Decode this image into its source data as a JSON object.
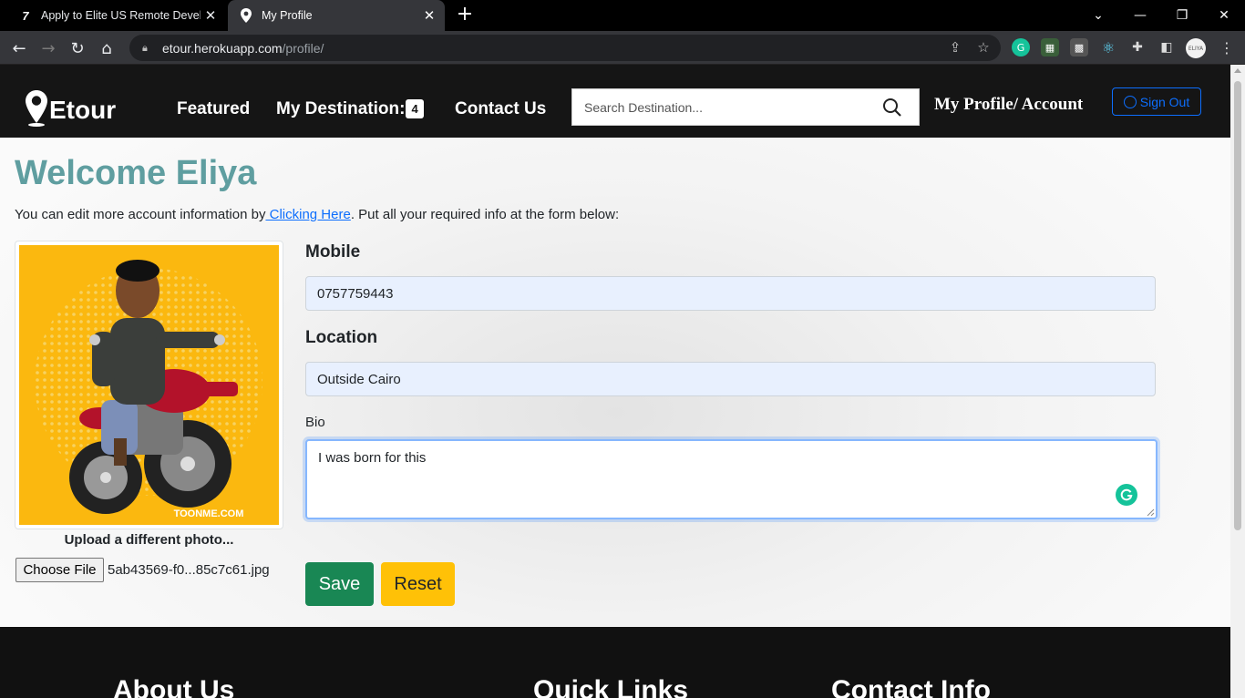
{
  "browser": {
    "tabs": [
      {
        "title": "Apply to Elite US Remote Develop",
        "active": false,
        "favicon": "turing-icon"
      },
      {
        "title": "My Profile",
        "active": true,
        "favicon": "etour-pin-icon"
      }
    ],
    "url_host": "etour.herokuapp.com",
    "url_path": "/profile/"
  },
  "nav": {
    "brand": "Etour",
    "featured": "Featured",
    "destinations": "My Destination:",
    "destinations_count": "4",
    "contact": "Contact Us",
    "search_placeholder": "Search Destination...",
    "profile": "My Profile/ Account",
    "signout": "Sign Out"
  },
  "main": {
    "welcome": "Welcome Eliya",
    "intro_before": "You can edit more account information by",
    "intro_link": " Clicking Here",
    "intro_after": ". Put all your required info at the form below:",
    "photo_caption": "TOONME.COM",
    "upload_label": "Upload a different photo...",
    "choose_file": "Choose File",
    "file_name": "5ab43569-f0...85c7c61.jpg"
  },
  "form": {
    "mobile_label": "Mobile",
    "mobile_value": "0757759443",
    "location_label": "Location",
    "location_value": "Outside Cairo",
    "bio_label": "Bio",
    "bio_value": "I was born for this",
    "save": "Save",
    "reset": "Reset"
  },
  "footer": {
    "about": "About Us",
    "links": "Quick Links",
    "contact": "Contact Info"
  },
  "colors": {
    "header_bg": "#151515",
    "welcome": "#5f9ea0",
    "save": "#198754",
    "reset": "#ffc107",
    "signout": "#0d6efd",
    "photo_bg": "#fbb80f"
  }
}
